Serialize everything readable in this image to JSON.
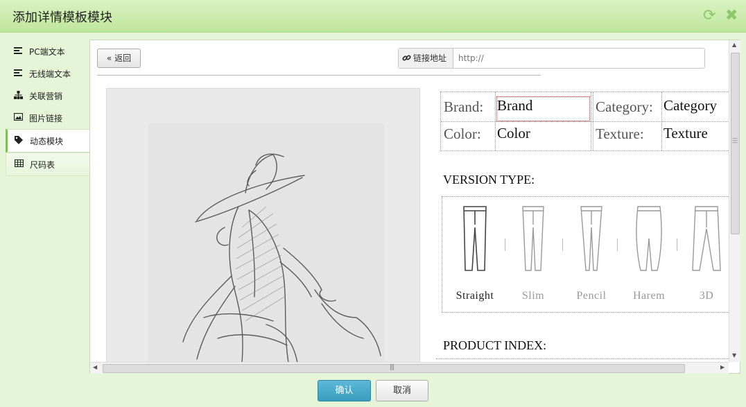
{
  "window": {
    "title": "添加详情模板模块",
    "refresh_icon": "refresh-icon",
    "close_icon": "close-icon",
    "accent_color": "#7fbf5a"
  },
  "sidebar": {
    "items": [
      {
        "label": "PC端文本",
        "icon": "align-left-icon",
        "active": false
      },
      {
        "label": "无线端文本",
        "icon": "align-left-icon",
        "active": false
      },
      {
        "label": "关联营销",
        "icon": "sitemap-icon",
        "active": false
      },
      {
        "label": "图片链接",
        "icon": "picture-icon",
        "active": false
      },
      {
        "label": "动态模块",
        "icon": "tag-icon",
        "active": true
      },
      {
        "label": "尺码表",
        "icon": "table-icon",
        "active": false
      }
    ]
  },
  "editor": {
    "back_label": "« 返回",
    "link_label": "链接地址",
    "link_placeholder": "http://",
    "link_value": ""
  },
  "template": {
    "attributes": [
      {
        "key": "Brand:",
        "value": "Brand"
      },
      {
        "key": "Category:",
        "value": "Category"
      },
      {
        "key": "Color:",
        "value": "Color"
      },
      {
        "key": "Texture:",
        "value": "Texture"
      }
    ],
    "version_heading": "VERSION TYPE:",
    "versions": [
      {
        "label": "Straight",
        "selected": true
      },
      {
        "label": "Slim",
        "selected": false
      },
      {
        "label": "Pencil",
        "selected": false
      },
      {
        "label": "Harem",
        "selected": false
      },
      {
        "label": "3D",
        "selected": false
      }
    ],
    "index_heading": "PRODUCT INDEX:"
  },
  "footer": {
    "confirm_label": "确认",
    "cancel_label": "取消"
  }
}
